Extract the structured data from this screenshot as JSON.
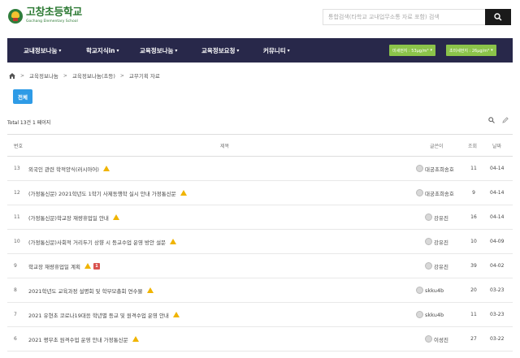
{
  "brand": {
    "name_ko": "고창초등학교",
    "name_en": "Gochang Elementary School"
  },
  "search": {
    "placeholder": "통합검색(타학교 교내업무소통 자료 포함) 검색"
  },
  "nav": {
    "items": [
      "교내정보나눔",
      "학교지식in",
      "교육정보나눔",
      "교육정보요청",
      "커뮤니티"
    ],
    "dust_fine": "미세먼지 : 53μg/m³",
    "dust_ultrafine": "초미세먼지 : 26μg/m³"
  },
  "breadcrumb": [
    "교육정보나눔",
    "교육정보나눔(초등)",
    "교무기획 자료"
  ],
  "category_all": "전체",
  "total_text": "Total 13건 1 페이지",
  "columns": {
    "no": "번호",
    "title": "제목",
    "writer": "글쓴이",
    "views": "조회",
    "date": "날짜"
  },
  "rows": [
    {
      "no": "13",
      "title": "외국인 관련 학적양식(러시아어)",
      "writer": "대궁초희송호",
      "views": "11",
      "date": "04-14",
      "new": false
    },
    {
      "no": "12",
      "title": "(가정통신문) 2021학년도 1학기 사제동행학 실시 안내 가정통신문",
      "writer": "대궁초희송호",
      "views": "9",
      "date": "04-14",
      "new": false
    },
    {
      "no": "11",
      "title": "(가정통신문)학교장 재량휴업일 안내",
      "writer": "강유진",
      "views": "16",
      "date": "04-14",
      "new": false
    },
    {
      "no": "10",
      "title": "(가정통신문)사회적 거리두기 상향 시 등교수업 운영 방안 설문",
      "writer": "강유진",
      "views": "10",
      "date": "04-09",
      "new": false
    },
    {
      "no": "9",
      "title": "학교장 재량휴업일 계획",
      "writer": "강유진",
      "views": "39",
      "date": "04-02",
      "new": true,
      "new_count": "1"
    },
    {
      "no": "8",
      "title": "2021학년도 교육과정 설명회 및 학부모총회 연수물",
      "writer": "skku4b",
      "views": "20",
      "date": "03-23",
      "new": false
    },
    {
      "no": "7",
      "title": "2021 유현초 코로나19대응 학년별 등교 및 원격수업 운영 안내",
      "writer": "skku4b",
      "views": "11",
      "date": "03-23",
      "new": false
    },
    {
      "no": "6",
      "title": "2021 평무초 원격수업 운영 안내 가정통신문",
      "writer": "이성진",
      "views": "27",
      "date": "03-22",
      "new": false
    }
  ]
}
